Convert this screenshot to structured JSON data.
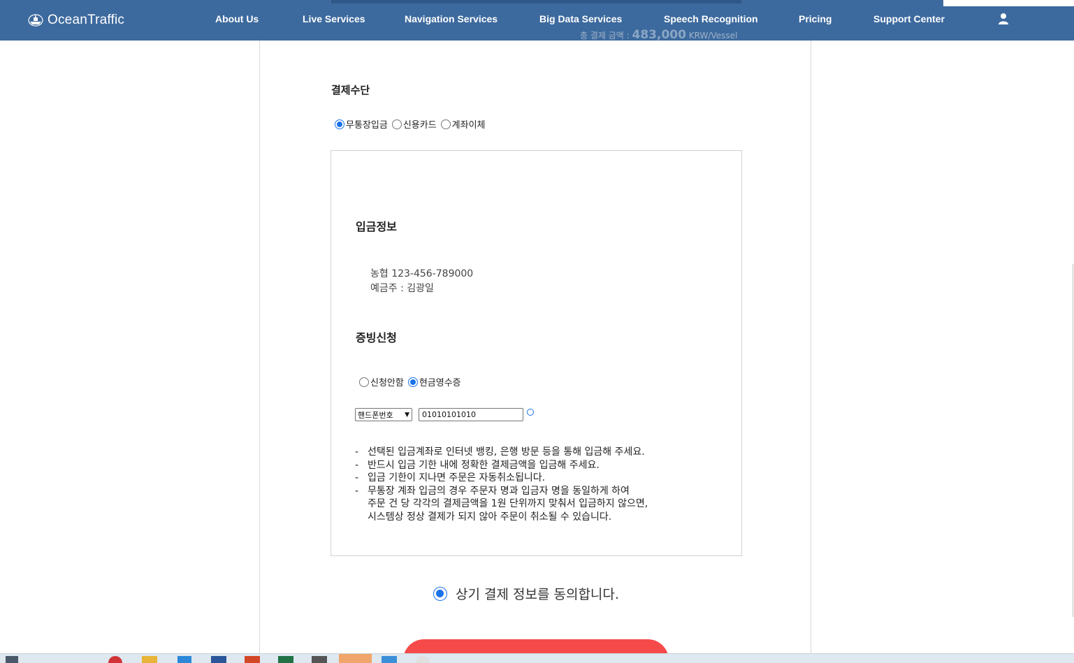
{
  "header": {
    "logo_text": "OceanTraffic",
    "nav": [
      {
        "label": "About Us"
      },
      {
        "label": "Live Services"
      },
      {
        "label": "Navigation Services"
      },
      {
        "label": "Big Data Services"
      },
      {
        "label": "Speech Recognition"
      },
      {
        "label": "Pricing"
      },
      {
        "label": "Support Center"
      }
    ],
    "user_icon": "user-icon"
  },
  "total": {
    "label": "총 결제 금액 :",
    "amount": "483,000",
    "unit": "KRW/Vessel"
  },
  "payment": {
    "title": "결제수단",
    "methods": [
      {
        "label": "무통장입금",
        "checked": true
      },
      {
        "label": "신용카드",
        "checked": false
      },
      {
        "label": "계좌이체",
        "checked": false
      }
    ]
  },
  "deposit": {
    "title": "입금정보",
    "bank_line": "농협 123-456-789000",
    "holder_line": "예금주 : 김광일"
  },
  "receipt": {
    "title": "증빙신청",
    "options": [
      {
        "label": "신청안함",
        "checked": false
      },
      {
        "label": "현금영수증",
        "checked": true
      }
    ],
    "select_value": "핸드폰번호",
    "phone_value": "01010101010"
  },
  "notes": [
    "선택된 입금계좌로 인터넷 뱅킹, 은행 방문 등을 통해 입금해 주세요.",
    "반드시 입금 기한 내에 정확한 결제금액을 입금해 주세요.",
    "입금 기한이 지나면 주문은 자동취소됩니다.",
    "무통장 계좌 입금의 경우 주문자 명과 입금자 명을 동일하게 하여\n주문 건 당 각각의 결제금액을 1원 단위까지 맞춰서 입금하지 않으면,\n시스템상 정상 결제가 되지 않아 주문이 취소될 수 있습니다."
  ],
  "agree": {
    "label": "상기 결제 정보를 동의합니다.",
    "checked": true
  },
  "colors": {
    "header_bg": "#3d6a9e",
    "accent": "#1a73e8",
    "pay_button": "#f64a4a"
  }
}
